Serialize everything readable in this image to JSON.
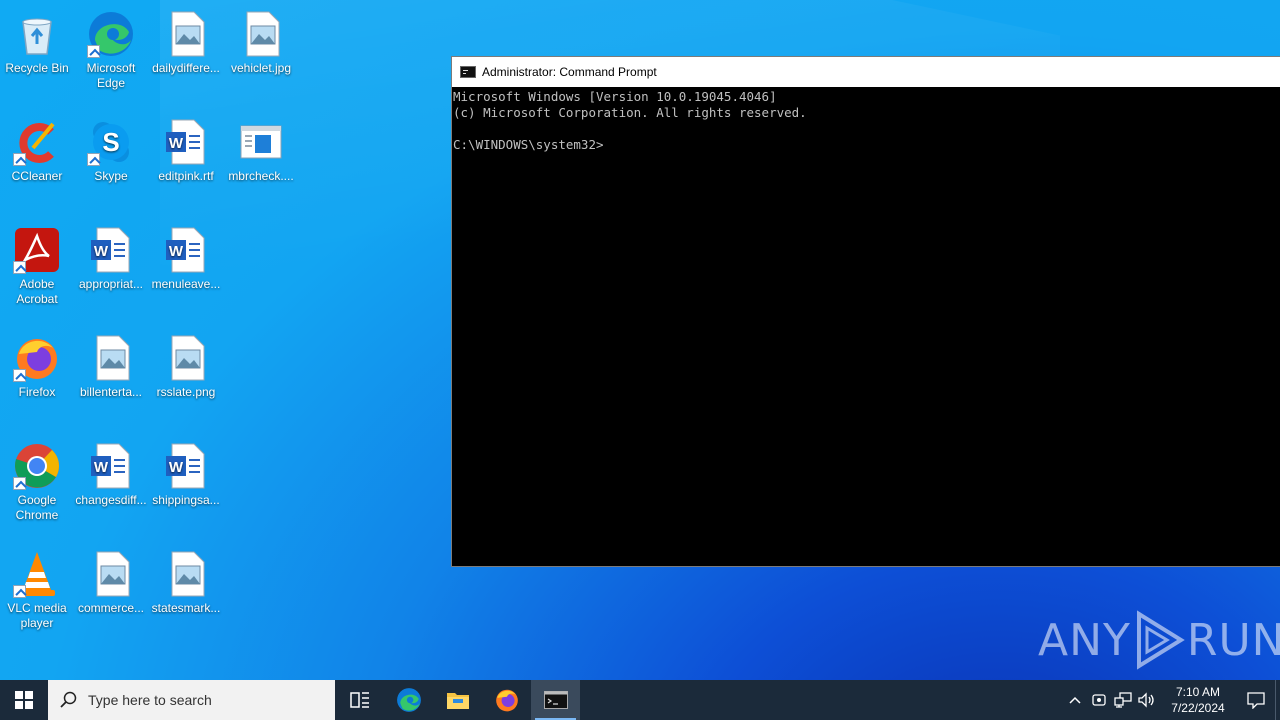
{
  "desktop": {
    "icons": [
      {
        "label": "Recycle Bin",
        "icon": "recycle-bin-icon"
      },
      {
        "label": "Microsoft Edge",
        "icon": "edge-icon"
      },
      {
        "label": "dailydiffere...",
        "icon": "image-file-icon"
      },
      {
        "label": "vehiclet.jpg",
        "icon": "image-file-icon"
      },
      {
        "label": "CCleaner",
        "icon": "ccleaner-icon"
      },
      {
        "label": "Skype",
        "icon": "skype-icon"
      },
      {
        "label": "editpink.rtf",
        "icon": "word-file-icon"
      },
      {
        "label": "mbrcheck....",
        "icon": "window-file-icon"
      },
      {
        "label": "Adobe Acrobat",
        "icon": "acrobat-icon"
      },
      {
        "label": "appropriat...",
        "icon": "word-file-icon"
      },
      {
        "label": "menuleave...",
        "icon": "word-file-icon"
      },
      {
        "label": "Firefox",
        "icon": "firefox-icon"
      },
      {
        "label": "billenterta...",
        "icon": "image-file-icon"
      },
      {
        "label": "rsslate.png",
        "icon": "image-file-icon"
      },
      {
        "label": "Google Chrome",
        "icon": "chrome-icon"
      },
      {
        "label": "changesdiff...",
        "icon": "word-file-icon"
      },
      {
        "label": "shippingsa...",
        "icon": "word-file-icon"
      },
      {
        "label": "VLC media player",
        "icon": "vlc-icon"
      },
      {
        "label": "commerce...",
        "icon": "image-file-icon"
      },
      {
        "label": "statesmark...",
        "icon": "image-file-icon"
      }
    ]
  },
  "cmd_window": {
    "title": "Administrator: Command Prompt",
    "lines": [
      "Microsoft Windows [Version 10.0.19045.4046]",
      "(c) Microsoft Corporation. All rights reserved.",
      "",
      "C:\\WINDOWS\\system32>"
    ]
  },
  "watermark": {
    "left": "ANY",
    "right": "RUN"
  },
  "taskbar": {
    "search_placeholder": "Type here to search",
    "apps": [
      "task-view-icon",
      "edge-icon",
      "file-explorer-icon",
      "firefox-icon",
      "cmd-icon"
    ],
    "clock_time": "7:10 AM",
    "clock_date": "7/22/2024"
  }
}
